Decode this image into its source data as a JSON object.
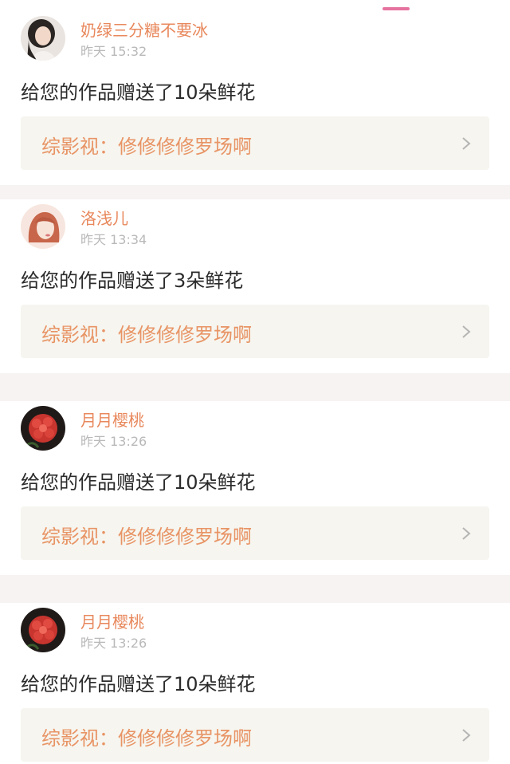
{
  "theme": {
    "accent": "#e6739f",
    "username_color": "#e8885c",
    "link_color": "#e89465"
  },
  "feed": [
    {
      "username": "奶绿三分糖不要冰",
      "time": "昨天 15:32",
      "message": "给您的作品赠送了10朵鲜花",
      "work_label": "综影视：修修修修罗场啊",
      "avatar_icon": "portrait-avatar-icon"
    },
    {
      "username": "洛浅儿",
      "time": "昨天 13:34",
      "message": "给您的作品赠送了3朵鲜花",
      "work_label": "综影视：修修修修罗场啊",
      "avatar_icon": "illustrated-girl-avatar-icon"
    },
    {
      "username": "月月樱桃",
      "time": "昨天 13:26",
      "message": "给您的作品赠送了10朵鲜花",
      "work_label": "综影视：修修修修罗场啊",
      "avatar_icon": "red-flower-avatar-icon"
    },
    {
      "username": "月月樱桃",
      "time": "昨天 13:26",
      "message": "给您的作品赠送了10朵鲜花",
      "work_label": "综影视：修修修修罗场啊",
      "avatar_icon": "red-flower-avatar-icon"
    }
  ]
}
